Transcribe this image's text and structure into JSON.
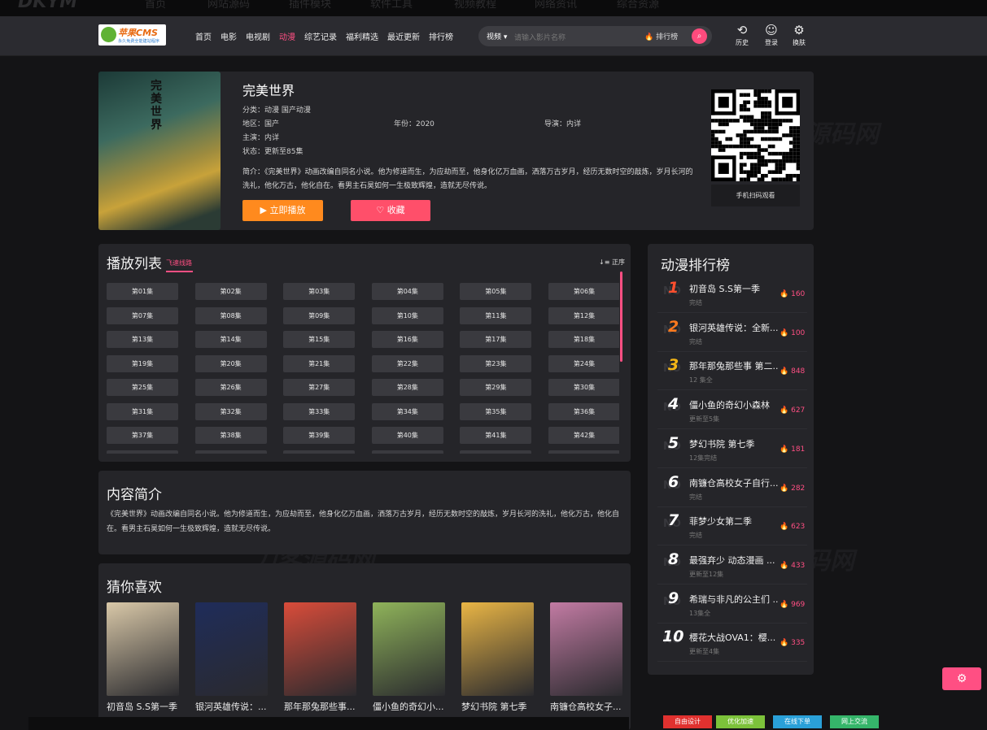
{
  "topstrip": [
    "DKYM",
    "首页",
    "网站源码",
    "插件模块",
    "软件工具",
    "视频教程",
    "网络资讯",
    "综合资源"
  ],
  "logo": {
    "text": "苹果CMS",
    "sub": "永久免费全能建站程序"
  },
  "nav": [
    {
      "label": "首页",
      "active": false
    },
    {
      "label": "电影",
      "active": false
    },
    {
      "label": "电视剧",
      "active": false
    },
    {
      "label": "动漫",
      "active": true
    },
    {
      "label": "综艺记录",
      "active": false
    },
    {
      "label": "福利精选",
      "active": false
    },
    {
      "label": "最近更新",
      "active": false
    },
    {
      "label": "排行榜",
      "active": false
    }
  ],
  "search": {
    "category": "视频",
    "placeholder": "请输入影片名称",
    "rank": "排行榜"
  },
  "header_icons": {
    "history": "历史",
    "login": "登录",
    "theme": "换肤"
  },
  "video": {
    "title": "完美世界",
    "category": "分类：动漫  国产动漫",
    "area": "地区：国产",
    "year": "年份：2020",
    "director": "导演：内详",
    "actors": "主演：内详",
    "status": "状态：更新至85集",
    "intro": "简介：《完美世界》动画改编自同名小说。他为修道而生，为应劫而至，他身化亿万血画，洒落万古岁月，经历无数时空的敲炼，岁月长河的洗礼，他化万古，他化自在。看男主石昊如何一生极致辉煌，造就无尽传说。",
    "play_label": "立即播放",
    "fav_label": "收藏",
    "qr_caption": "手机扫码观看"
  },
  "playlist": {
    "title": "播放列表",
    "line": "飞速线路",
    "sort": "正序",
    "episodes": [
      "第01集",
      "第02集",
      "第03集",
      "第04集",
      "第05集",
      "第06集",
      "第07集",
      "第08集",
      "第09集",
      "第10集",
      "第11集",
      "第12集",
      "第13集",
      "第14集",
      "第15集",
      "第16集",
      "第17集",
      "第18集",
      "第19集",
      "第20集",
      "第21集",
      "第22集",
      "第23集",
      "第24集",
      "第25集",
      "第26集",
      "第27集",
      "第28集",
      "第29集",
      "第30集",
      "第31集",
      "第32集",
      "第33集",
      "第34集",
      "第35集",
      "第36集",
      "第37集",
      "第38集",
      "第39集",
      "第40集",
      "第41集",
      "第42集"
    ]
  },
  "intro_panel": {
    "title": "内容简介",
    "text": "《完美世界》动画改编自同名小说。他为修道而生，为应劫而至，他身化亿万血画，洒落万古岁月，经历无数时空的敲炼，岁月长河的洗礼，他化万古，他化自在。看男主石昊如何一生极致辉煌，造就无尽传说。"
  },
  "recommend": {
    "title": "猜你喜欢",
    "items": [
      {
        "name": "初音岛 S.S第一季",
        "color": "#d9c8a8"
      },
      {
        "name": "银河英雄传说：...",
        "color": "#1f2c5a"
      },
      {
        "name": "那年那兔那些事...",
        "color": "#d94c3a"
      },
      {
        "name": "僵小鱼的奇幻小...",
        "color": "#8fb35a"
      },
      {
        "name": "梦幻书院 第七季",
        "color": "#e9b545"
      },
      {
        "name": "南镰仓高校女子...",
        "color": "#c27ba3"
      }
    ]
  },
  "ranking": {
    "title": "动漫排行榜",
    "items": [
      {
        "rank": "1",
        "title": "初音岛 S.S第一季",
        "status": "完结",
        "hits": "160",
        "color": "#ff4f2e"
      },
      {
        "rank": "2",
        "title": "银河英雄传说：全新...",
        "status": "完结",
        "hits": "100",
        "color": "#ff7a1e"
      },
      {
        "rank": "3",
        "title": "那年那兔那些事 第二...",
        "status": "12 集全",
        "hits": "848",
        "color": "#f5b616"
      },
      {
        "rank": "4",
        "title": "僵小鱼的奇幻小森林",
        "status": "更新至5集",
        "hits": "627",
        "color": "#ffffff"
      },
      {
        "rank": "5",
        "title": "梦幻书院 第七季",
        "status": "12集完结",
        "hits": "181",
        "color": "#ffffff"
      },
      {
        "rank": "6",
        "title": "南镰仓高校女子自行...",
        "status": "完结",
        "hits": "282",
        "color": "#ffffff"
      },
      {
        "rank": "7",
        "title": "菲梦少女第二季",
        "status": "完结",
        "hits": "623",
        "color": "#ffffff"
      },
      {
        "rank": "8",
        "title": "最强弃少 动态漫画 ...",
        "status": "更新至12集",
        "hits": "433",
        "color": "#ffffff"
      },
      {
        "rank": "9",
        "title": "希瑞与非凡的公主们 ...",
        "status": "13集全",
        "hits": "969",
        "color": "#ffffff"
      },
      {
        "rank": "10",
        "title": "樱花大战OVA1：樱...",
        "status": "更新至4集",
        "hits": "335",
        "color": "#ffffff"
      }
    ]
  },
  "watermark": "刀客源码网",
  "footer_buttons": [
    {
      "label": "自由设计",
      "color": "#e0312f"
    },
    {
      "label": "优化加速",
      "color": "#7cc23a"
    },
    {
      "label": "在线下单",
      "color": "#2aa0d8"
    },
    {
      "label": "网上交流",
      "color": "#35b56a"
    }
  ]
}
